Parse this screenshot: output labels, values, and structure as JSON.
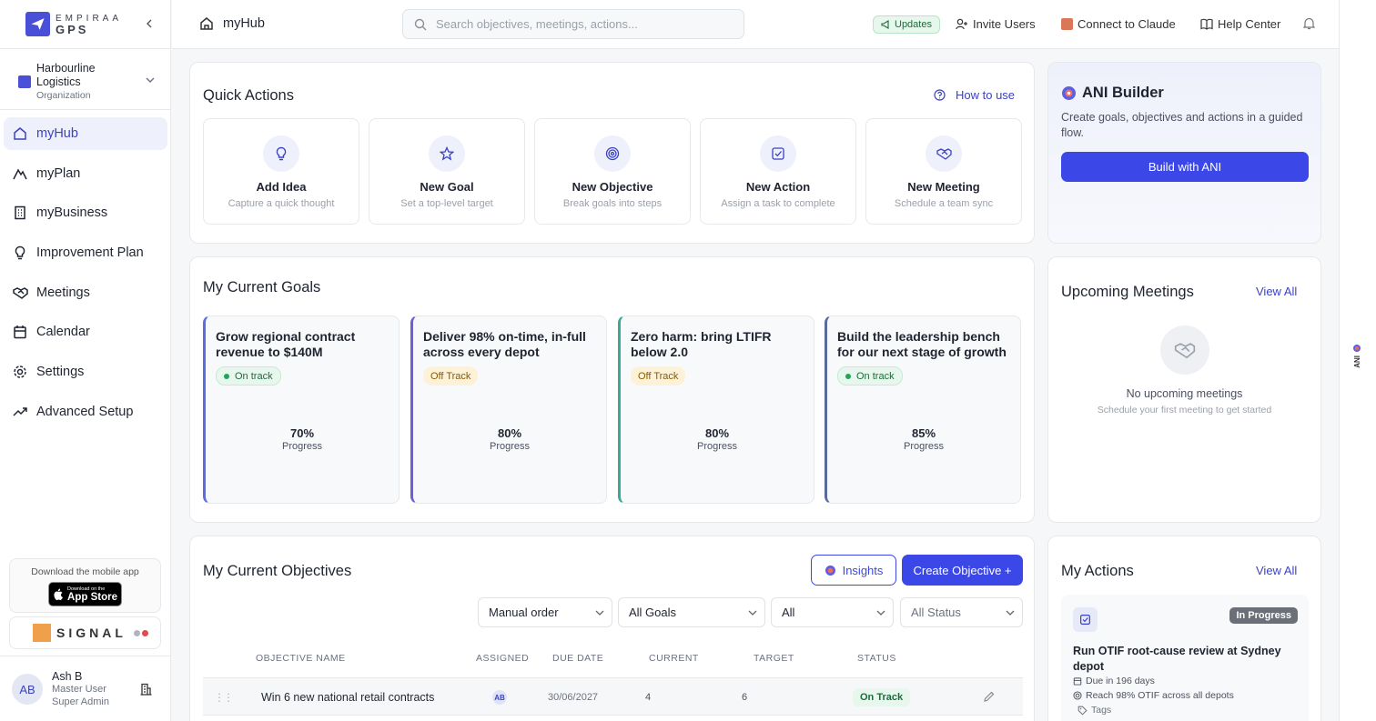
{
  "brand": {
    "line1": "EMPIRAA",
    "line2": "GPS"
  },
  "org": {
    "name": "Harbourline Logistics",
    "type": "Organization"
  },
  "nav": [
    {
      "label": "myHub",
      "icon": "home-icon",
      "active": true
    },
    {
      "label": "myPlan",
      "icon": "mountain-icon"
    },
    {
      "label": "myBusiness",
      "icon": "building-icon"
    },
    {
      "label": "Improvement Plan",
      "icon": "lightbulb-icon"
    },
    {
      "label": "Meetings",
      "icon": "handshake-icon"
    },
    {
      "label": "Calendar",
      "icon": "calendar-icon"
    },
    {
      "label": "Settings",
      "icon": "gear-icon"
    },
    {
      "label": "Advanced Setup",
      "icon": "trending-icon"
    }
  ],
  "mobile_app": {
    "text": "Download the mobile app",
    "store_small": "Download on the",
    "store_big": "App Store"
  },
  "signal": {
    "label": "SIGNAL"
  },
  "user": {
    "initials": "AB",
    "name": "Ash B",
    "role": "Master User",
    "role2": "Super Admin"
  },
  "topbar": {
    "title": "myHub",
    "search_placeholder": "Search objectives, meetings, actions...",
    "updates": "Updates",
    "invite": "Invite Users",
    "connect": "Connect to Claude",
    "help": "Help Center"
  },
  "right_tab": {
    "label": "ANI"
  },
  "quick_actions": {
    "title": "Quick Actions",
    "how_to": "How to use",
    "items": [
      {
        "title": "Add Idea",
        "subtitle": "Capture a quick thought",
        "icon": "lightbulb-icon"
      },
      {
        "title": "New Goal",
        "subtitle": "Set a top-level target",
        "icon": "star-icon"
      },
      {
        "title": "New Objective",
        "subtitle": "Break goals into steps",
        "icon": "target-icon"
      },
      {
        "title": "New Action",
        "subtitle": "Assign a task to complete",
        "icon": "checkbox-icon"
      },
      {
        "title": "New Meeting",
        "subtitle": "Schedule a team sync",
        "icon": "handshake-icon"
      }
    ]
  },
  "ani_builder": {
    "title": "ANI Builder",
    "description": "Create goals, objectives and actions in a guided flow.",
    "button": "Build with ANI"
  },
  "goals": {
    "title": "My Current Goals",
    "items": [
      {
        "title": "Grow regional contract revenue to $140M",
        "status": "On track",
        "status_type": "on",
        "progress": "70%",
        "progress_label": "Progress",
        "accent": "#5b6ee1"
      },
      {
        "title": "Deliver 98% on-time, in-full across every depot",
        "status": "Off Track",
        "status_type": "off",
        "progress": "80%",
        "progress_label": "Progress",
        "accent": "#6f5fd6"
      },
      {
        "title": "Zero harm: bring LTIFR below 2.0",
        "status": "Off Track",
        "status_type": "off",
        "progress": "80%",
        "progress_label": "Progress",
        "accent": "#3aa89a"
      },
      {
        "title": "Build the leadership bench for our next stage of growth",
        "status": "On track",
        "status_type": "on",
        "progress": "85%",
        "progress_label": "Progress",
        "accent": "#5a6a9a"
      }
    ]
  },
  "meetings": {
    "title": "Upcoming Meetings",
    "view_all": "View All",
    "empty_title": "No upcoming meetings",
    "empty_sub": "Schedule your first meeting to get started"
  },
  "objectives": {
    "title": "My Current Objectives",
    "insights": "Insights",
    "create": "Create Objective +",
    "filters": [
      "Manual order",
      "All Goals",
      "All",
      "All Status"
    ],
    "columns": [
      "OBJECTIVE NAME",
      "ASSIGNED",
      "DUE DATE",
      "CURRENT",
      "TARGET",
      "STATUS"
    ],
    "rows": [
      {
        "name": "Win 6 new national retail contracts",
        "assigned": "AB",
        "due": "30/06/2027",
        "current": "4",
        "target": "6",
        "status": "On Track"
      }
    ]
  },
  "actions": {
    "title": "My Actions",
    "view_all": "View All",
    "item": {
      "status": "In Progress",
      "title": "Run OTIF root-cause review at Sydney depot",
      "due": "Due in 196 days",
      "linked": "Reach 98% OTIF across all depots",
      "tags": "Tags"
    }
  }
}
